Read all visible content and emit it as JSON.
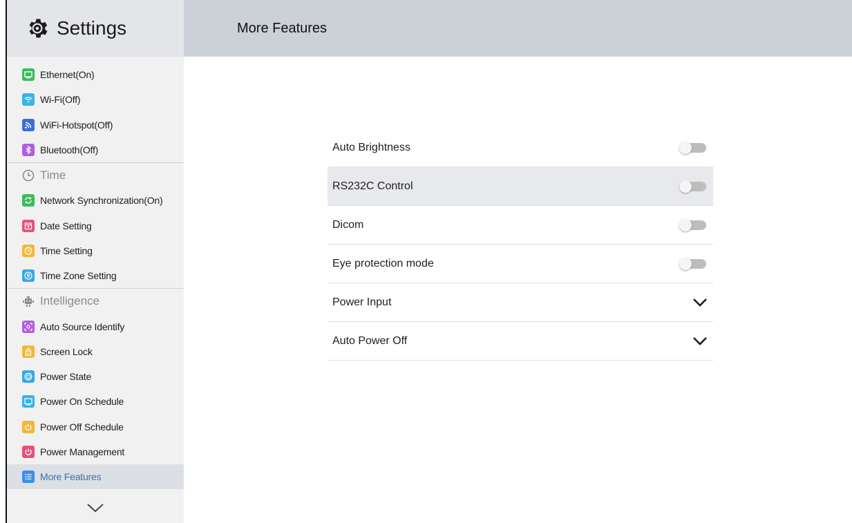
{
  "sidebar": {
    "title": "Settings",
    "network_items": [
      {
        "label": "Ethernet(On)",
        "icon": "ethernet-icon",
        "color": "#3dbb5a"
      },
      {
        "label": "Wi-Fi(Off)",
        "icon": "wifi-icon",
        "color": "#39b3e8"
      },
      {
        "label": "WiFi-Hotspot(Off)",
        "icon": "hotspot-icon",
        "color": "#3a6fd8"
      },
      {
        "label": "Bluetooth(Off)",
        "icon": "bluetooth-icon",
        "color": "#b05ee0"
      }
    ],
    "time_section": {
      "label": "Time",
      "icon": "clock-icon"
    },
    "time_items": [
      {
        "label": "Network Synchronization(On)",
        "icon": "sync-icon",
        "color": "#3dbb5a"
      },
      {
        "label": "Date Setting",
        "icon": "calendar-icon",
        "color": "#e8507a"
      },
      {
        "label": "Time Setting",
        "icon": "clock-icon",
        "color": "#f2b73a"
      },
      {
        "label": "Time Zone Setting",
        "icon": "location-icon",
        "color": "#39a6e8"
      }
    ],
    "intelligence_section": {
      "label": "Intelligence",
      "icon": "robot-icon"
    },
    "intelligence_items": [
      {
        "label": "Auto Source Identify",
        "icon": "scan-icon",
        "color": "#b05ee0"
      },
      {
        "label": "Screen Lock",
        "icon": "lock-icon",
        "color": "#f2b73a"
      },
      {
        "label": "Power State",
        "icon": "power-state-icon",
        "color": "#39a6e8"
      },
      {
        "label": "Power On Schedule",
        "icon": "monitor-icon",
        "color": "#39b3e8"
      },
      {
        "label": "Power Off Schedule",
        "icon": "power-off-icon",
        "color": "#f2b73a"
      },
      {
        "label": "Power Management",
        "icon": "power-icon",
        "color": "#e8507a"
      },
      {
        "label": "More Features",
        "icon": "list-icon",
        "color": "#3a8fe8"
      }
    ]
  },
  "header": {
    "title": "More Features"
  },
  "main": {
    "rows": [
      {
        "label": "Auto Brightness",
        "control": "toggle",
        "on": false
      },
      {
        "label": "RS232C Control",
        "control": "toggle",
        "on": false
      },
      {
        "label": "Dicom",
        "control": "toggle",
        "on": false
      },
      {
        "label": "Eye protection mode",
        "control": "toggle",
        "on": false
      },
      {
        "label": "Power Input",
        "control": "dropdown"
      },
      {
        "label": "Auto Power Off",
        "control": "dropdown"
      }
    ]
  }
}
